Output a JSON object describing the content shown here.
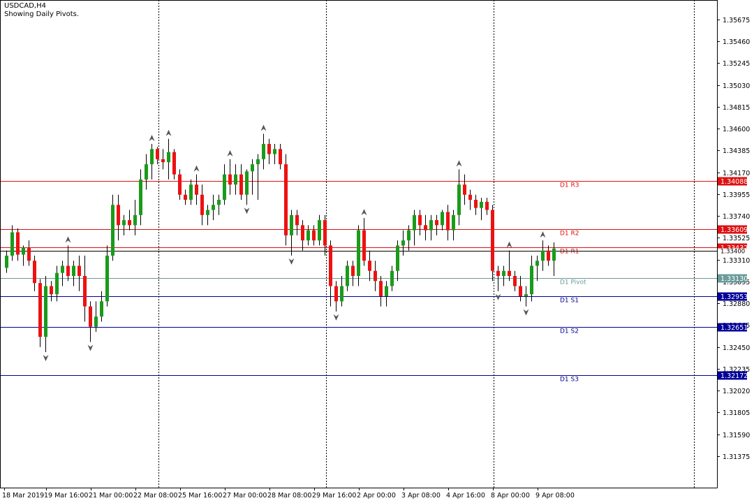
{
  "window": {
    "symbol_timeframe": "USDCAD,H4",
    "indicator_note": "Showing Daily Pivots."
  },
  "colors": {
    "background": "#ffffff",
    "bull_candle": "#1a9c1a",
    "bear_candle": "#ee1111",
    "resistance_line": "#dd1111",
    "support_line": "#000099",
    "pivot_line": "#6a9a9a",
    "current_price_line": "#000000",
    "fractal_marker": "#555555"
  },
  "chart_data": {
    "type": "candlestick",
    "symbol": "USDCAD",
    "timeframe": "H4",
    "y_range": [
      1.3123,
      1.35765
    ],
    "grid": false,
    "x_ticks": [
      "18 Mar 2019",
      "19 Mar 16:00",
      "21 Mar 00:00",
      "22 Mar 08:00",
      "25 Mar 16:00",
      "27 Mar 00:00",
      "28 Mar 08:00",
      "29 Mar 16:00",
      "2 Apr 00:00",
      "3 Apr 08:00",
      "4 Apr 16:00",
      "8 Apr 00:00",
      "9 Apr 08:00"
    ],
    "y_ticks": [
      "1.35675",
      "1.35460",
      "1.35245",
      "1.35030",
      "1.34815",
      "1.34600",
      "1.34385",
      "1.34170",
      "1.33955",
      "1.33740",
      "1.33525",
      "1.33310",
      "1.33095",
      "1.32880",
      "1.32665",
      "1.32450",
      "1.32235",
      "1.32020",
      "1.31805",
      "1.31590",
      "1.31375"
    ],
    "y_tick_values": [
      1.35675,
      1.3546,
      1.35245,
      1.3503,
      1.34815,
      1.346,
      1.34385,
      1.3417,
      1.33955,
      1.3374,
      1.33525,
      1.3331,
      1.33095,
      1.3288,
      1.32665,
      1.3245,
      1.32235,
      1.3202,
      1.31805,
      1.3159,
      1.31375
    ],
    "day_separators_after_tick": [
      "22 Mar 08:00",
      "29 Mar 16:00",
      "8 Apr 00:00"
    ],
    "pivot_levels": [
      {
        "name": "D1 R3",
        "value": 1.34088,
        "price_label": "1.34088",
        "kind": "resistance"
      },
      {
        "name": "D1 R2",
        "value": 1.33609,
        "price_label": "1.33609",
        "kind": "resistance"
      },
      {
        "name": "D1 R1",
        "value": 1.33432,
        "price_label": "1.33432",
        "kind": "resistance"
      },
      {
        "name": "D1 Pivot",
        "value": 1.3313,
        "price_label": "1.33130",
        "kind": "pivot"
      },
      {
        "name": "D1 S1",
        "value": 1.32953,
        "price_label": "1.32953",
        "kind": "support"
      },
      {
        "name": "D1 S2",
        "value": 1.32651,
        "price_label": "1.32651",
        "kind": "support"
      },
      {
        "name": "D1 S3",
        "value": 1.32172,
        "price_label": "1.32172",
        "kind": "support"
      }
    ],
    "current_price": 1.334,
    "current_price_label": "1.33400",
    "ohlc": [
      [
        1.3323,
        1.334,
        1.3318,
        1.3335
      ],
      [
        1.3335,
        1.3365,
        1.333,
        1.3358
      ],
      [
        1.3358,
        1.3362,
        1.333,
        1.3336
      ],
      [
        1.3336,
        1.3345,
        1.3325,
        1.3343
      ],
      [
        1.3343,
        1.335,
        1.3325,
        1.333
      ],
      [
        1.333,
        1.3335,
        1.33,
        1.3308
      ],
      [
        1.3308,
        1.3312,
        1.3245,
        1.3255
      ],
      [
        1.3255,
        1.3315,
        1.324,
        1.3305
      ],
      [
        1.3305,
        1.331,
        1.329,
        1.3297
      ],
      [
        1.3297,
        1.3325,
        1.329,
        1.3318
      ],
      [
        1.3318,
        1.333,
        1.3305,
        1.3325
      ],
      [
        1.3325,
        1.3345,
        1.331,
        1.3315
      ],
      [
        1.3315,
        1.333,
        1.3305,
        1.3325
      ],
      [
        1.3325,
        1.3335,
        1.33,
        1.3315
      ],
      [
        1.3315,
        1.3335,
        1.327,
        1.3285
      ],
      [
        1.3285,
        1.329,
        1.325,
        1.3265
      ],
      [
        1.3265,
        1.329,
        1.326,
        1.3275
      ],
      [
        1.3275,
        1.33,
        1.327,
        1.329
      ],
      [
        1.329,
        1.3345,
        1.3285,
        1.3335
      ],
      [
        1.3335,
        1.3395,
        1.333,
        1.3385
      ],
      [
        1.3385,
        1.3395,
        1.335,
        1.3365
      ],
      [
        1.3365,
        1.3375,
        1.3355,
        1.337
      ],
      [
        1.337,
        1.338,
        1.336,
        1.3365
      ],
      [
        1.3365,
        1.339,
        1.3355,
        1.3375
      ],
      [
        1.3375,
        1.342,
        1.3365,
        1.341
      ],
      [
        1.341,
        1.3435,
        1.34,
        1.3425
      ],
      [
        1.3425,
        1.3445,
        1.341,
        1.344
      ],
      [
        1.344,
        1.3442,
        1.3425,
        1.343
      ],
      [
        1.343,
        1.344,
        1.342,
        1.3427
      ],
      [
        1.3427,
        1.345,
        1.341,
        1.3437
      ],
      [
        1.3437,
        1.344,
        1.341,
        1.3415
      ],
      [
        1.3415,
        1.342,
        1.339,
        1.3395
      ],
      [
        1.3395,
        1.34,
        1.3385,
        1.339
      ],
      [
        1.339,
        1.341,
        1.3385,
        1.3405
      ],
      [
        1.3405,
        1.3415,
        1.3385,
        1.3395
      ],
      [
        1.3395,
        1.3405,
        1.3365,
        1.3375
      ],
      [
        1.3375,
        1.3385,
        1.3365,
        1.338
      ],
      [
        1.338,
        1.3395,
        1.337,
        1.3385
      ],
      [
        1.3385,
        1.3395,
        1.3375,
        1.339
      ],
      [
        1.339,
        1.3425,
        1.3385,
        1.3415
      ],
      [
        1.3415,
        1.343,
        1.3395,
        1.3405
      ],
      [
        1.3405,
        1.3425,
        1.3395,
        1.3415
      ],
      [
        1.3415,
        1.3425,
        1.339,
        1.3395
      ],
      [
        1.3395,
        1.342,
        1.3385,
        1.3418
      ],
      [
        1.3418,
        1.343,
        1.3395,
        1.3425
      ],
      [
        1.3425,
        1.3435,
        1.339,
        1.343
      ],
      [
        1.343,
        1.3455,
        1.342,
        1.3445
      ],
      [
        1.3445,
        1.345,
        1.3425,
        1.3435
      ],
      [
        1.3435,
        1.3445,
        1.3425,
        1.344
      ],
      [
        1.344,
        1.3445,
        1.342,
        1.3425
      ],
      [
        1.3425,
        1.3435,
        1.3345,
        1.3355
      ],
      [
        1.3355,
        1.338,
        1.3335,
        1.3375
      ],
      [
        1.3375,
        1.338,
        1.3355,
        1.3365
      ],
      [
        1.3365,
        1.337,
        1.334,
        1.335
      ],
      [
        1.335,
        1.3365,
        1.3345,
        1.336
      ],
      [
        1.336,
        1.3365,
        1.3345,
        1.335
      ],
      [
        1.335,
        1.3375,
        1.3345,
        1.337
      ],
      [
        1.337,
        1.3375,
        1.3335,
        1.3345
      ],
      [
        1.3345,
        1.335,
        1.3285,
        1.3305
      ],
      [
        1.3305,
        1.331,
        1.328,
        1.329
      ],
      [
        1.329,
        1.3315,
        1.3285,
        1.3305
      ],
      [
        1.3305,
        1.333,
        1.33,
        1.3325
      ],
      [
        1.3325,
        1.333,
        1.3305,
        1.3315
      ],
      [
        1.3315,
        1.3365,
        1.3305,
        1.336
      ],
      [
        1.336,
        1.3372,
        1.3325,
        1.333
      ],
      [
        1.333,
        1.334,
        1.331,
        1.332
      ],
      [
        1.332,
        1.333,
        1.33,
        1.331
      ],
      [
        1.331,
        1.3315,
        1.3285,
        1.3295
      ],
      [
        1.3295,
        1.331,
        1.3285,
        1.3305
      ],
      [
        1.3305,
        1.3325,
        1.33,
        1.332
      ],
      [
        1.332,
        1.335,
        1.331,
        1.3345
      ],
      [
        1.3345,
        1.336,
        1.3335,
        1.335
      ],
      [
        1.335,
        1.3365,
        1.334,
        1.336
      ],
      [
        1.336,
        1.338,
        1.3345,
        1.3375
      ],
      [
        1.3375,
        1.338,
        1.3355,
        1.3365
      ],
      [
        1.3365,
        1.3375,
        1.335,
        1.336
      ],
      [
        1.336,
        1.3375,
        1.335,
        1.337
      ],
      [
        1.337,
        1.3375,
        1.3355,
        1.3365
      ],
      [
        1.3365,
        1.338,
        1.336,
        1.3378
      ],
      [
        1.3378,
        1.3385,
        1.335,
        1.336
      ],
      [
        1.336,
        1.338,
        1.335,
        1.3375
      ],
      [
        1.3375,
        1.342,
        1.3365,
        1.3405
      ],
      [
        1.3405,
        1.3415,
        1.3385,
        1.3395
      ],
      [
        1.3395,
        1.34,
        1.338,
        1.339
      ],
      [
        1.339,
        1.3395,
        1.3375,
        1.3382
      ],
      [
        1.3382,
        1.3392,
        1.337,
        1.3388
      ],
      [
        1.3388,
        1.3392,
        1.3375,
        1.338
      ],
      [
        1.338,
        1.3385,
        1.331,
        1.332
      ],
      [
        1.332,
        1.3325,
        1.33,
        1.3315
      ],
      [
        1.3315,
        1.3325,
        1.3305,
        1.332
      ],
      [
        1.332,
        1.334,
        1.331,
        1.3315
      ],
      [
        1.3315,
        1.332,
        1.33,
        1.3305
      ],
      [
        1.3305,
        1.3315,
        1.329,
        1.3295
      ],
      [
        1.3295,
        1.3305,
        1.3285,
        1.3297
      ],
      [
        1.3297,
        1.3335,
        1.329,
        1.3325
      ],
      [
        1.3325,
        1.3335,
        1.331,
        1.333
      ],
      [
        1.333,
        1.335,
        1.332,
        1.334
      ],
      [
        1.334,
        1.3345,
        1.3325,
        1.333
      ],
      [
        1.333,
        1.3348,
        1.3315,
        1.3342
      ]
    ]
  }
}
